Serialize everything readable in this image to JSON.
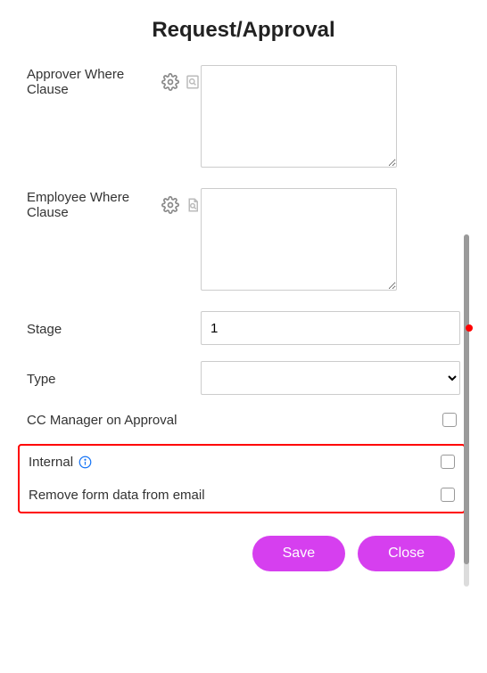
{
  "title": "Request/Approval",
  "fields": {
    "approver_where": {
      "label": "Approver Where Clause",
      "value": ""
    },
    "employee_where": {
      "label": "Employee Where Clause",
      "value": ""
    },
    "stage": {
      "label": "Stage",
      "value": "1"
    },
    "type": {
      "label": "Type",
      "value": ""
    },
    "cc_manager": {
      "label": "CC Manager on Approval",
      "checked": false
    },
    "internal": {
      "label": "Internal",
      "checked": false
    },
    "remove_form_data": {
      "label": "Remove form data from email",
      "checked": false
    }
  },
  "buttons": {
    "save": "Save",
    "close": "Close"
  }
}
